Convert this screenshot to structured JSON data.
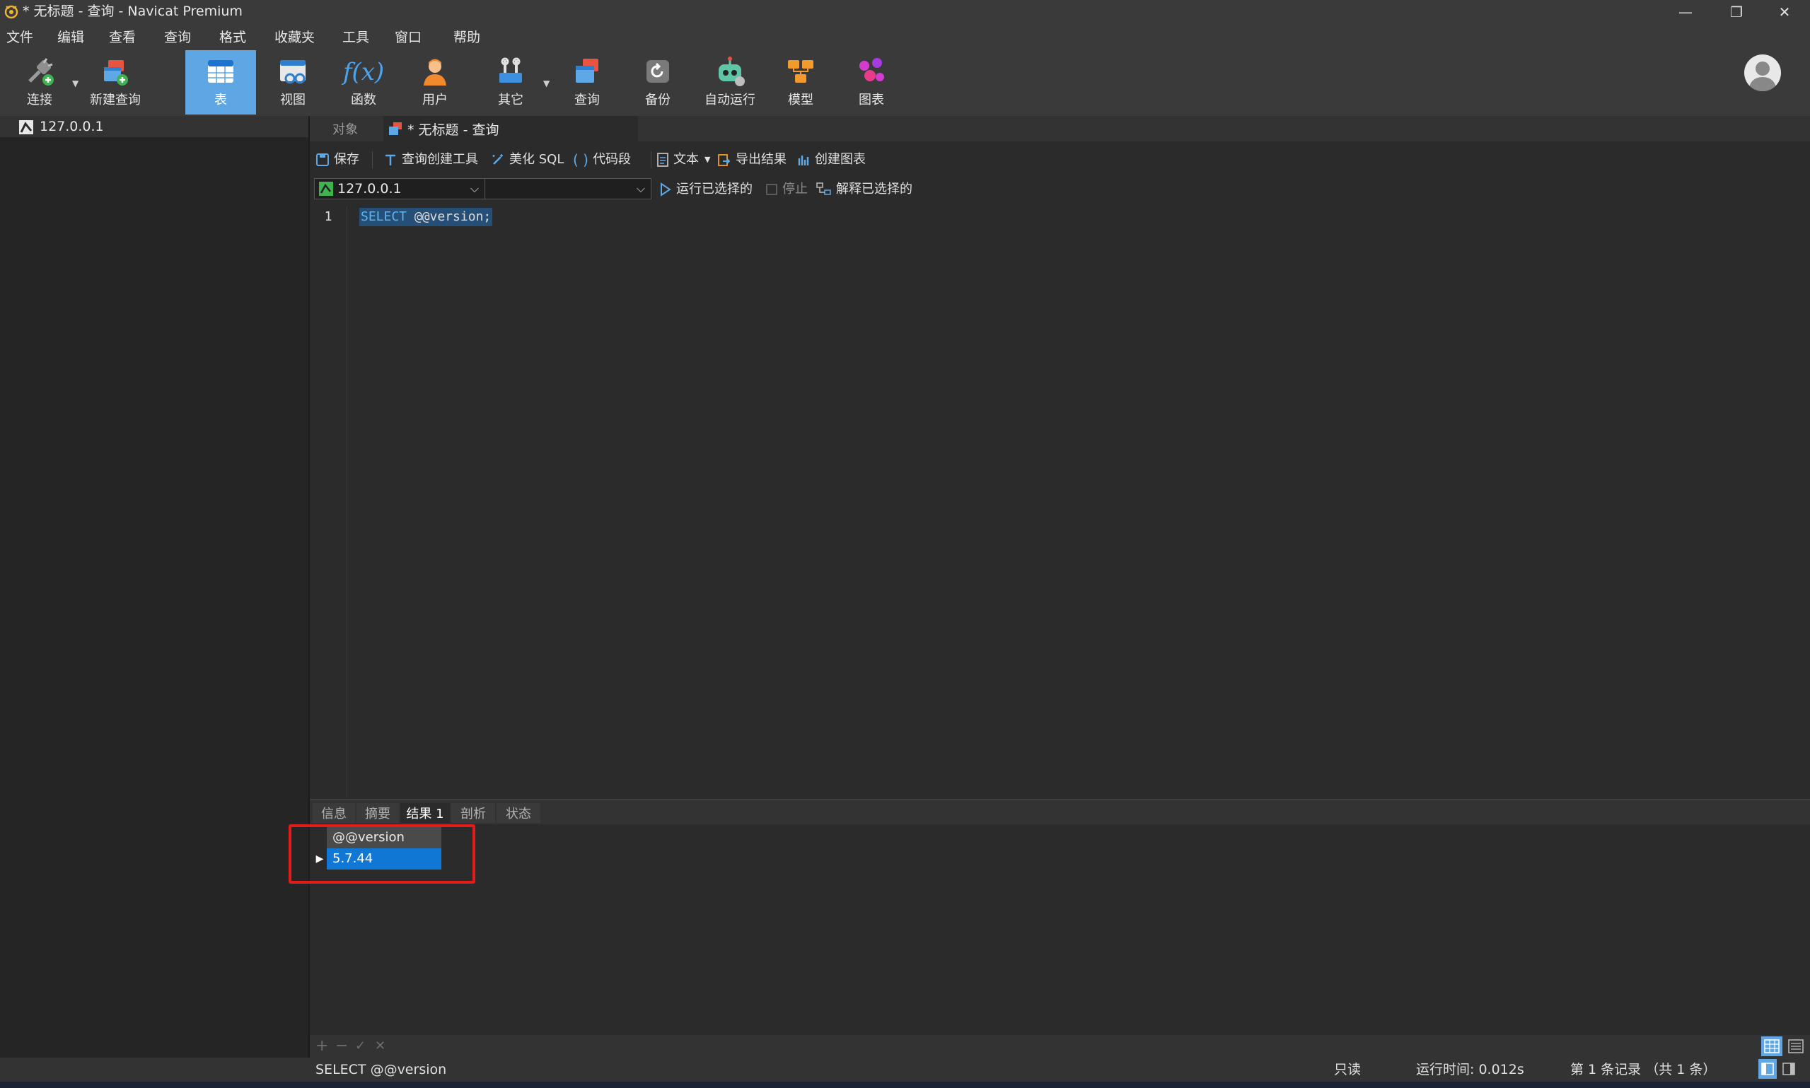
{
  "window": {
    "title": "* 无标题 - 查询 - Navicat Premium",
    "controls": [
      "—",
      "❐",
      "✕"
    ]
  },
  "menu": [
    "文件",
    "编辑",
    "查看",
    "查询",
    "格式",
    "收藏夹",
    "工具",
    "窗口",
    "帮助"
  ],
  "toolbar": {
    "items": [
      {
        "label": "连接",
        "icon": "plug-connect-icon"
      },
      {
        "label": "新建查询",
        "icon": "new-query-icon"
      },
      {
        "label": "表",
        "icon": "table-icon",
        "active": true
      },
      {
        "label": "视图",
        "icon": "view-icon"
      },
      {
        "label": "函数",
        "icon": "function-icon",
        "glyph": "f(x)"
      },
      {
        "label": "用户",
        "icon": "user-icon"
      },
      {
        "label": "其它",
        "icon": "tools-icon"
      },
      {
        "label": "查询",
        "icon": "query-icon"
      },
      {
        "label": "备份",
        "icon": "backup-icon"
      },
      {
        "label": "自动运行",
        "icon": "robot-icon"
      },
      {
        "label": "模型",
        "icon": "model-icon"
      },
      {
        "label": "图表",
        "icon": "chart-icon"
      }
    ]
  },
  "navigator": {
    "connection": "127.0.0.1"
  },
  "tabs": {
    "objects": "对象",
    "query": "* 无标题 - 查询"
  },
  "query_toolbar": {
    "save": "保存",
    "query_builder": "查询创建工具",
    "beautify": "美化 SQL",
    "snippet": "代码段",
    "text": "文本",
    "export": "导出结果",
    "create_chart": "创建图表"
  },
  "selector": {
    "connection": "127.0.0.1",
    "database": "",
    "run_selected": "运行已选择的",
    "stop": "停止",
    "explain_selected": "解释已选择的"
  },
  "editor": {
    "line_number": "1",
    "keyword": "SELECT",
    "rest": " @@version;"
  },
  "result_tabs": [
    "信息",
    "摘要",
    "结果 1",
    "剖析",
    "状态"
  ],
  "active_result_tab": "结果 1",
  "result": {
    "column": "@@version",
    "row_value": "5.7.44",
    "row_marker": "▶"
  },
  "grid_controls": [
    "+",
    "−",
    "✓",
    "✕"
  ],
  "status": {
    "sql": "SELECT @@version",
    "readonly": "只读",
    "runtime": "运行时间: 0.012s",
    "records": "第 1 条记录 （共 1 条）"
  },
  "colors": {
    "active_tool": "#5ea7e4",
    "selected_row": "#1177d4",
    "highlight": "#e21b1b",
    "keyword": "#5cb6f2"
  }
}
